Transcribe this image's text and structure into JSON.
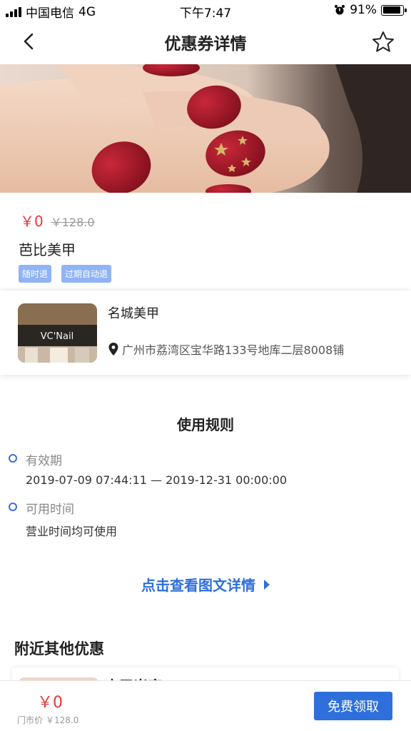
{
  "status_bar": {
    "carrier": "中国电信",
    "network": "4G",
    "time": "下午7:47",
    "battery": "91%"
  },
  "nav": {
    "title": "优惠券详情",
    "back_icon": "chevron-left-icon",
    "favorite_icon": "star-outline-icon"
  },
  "product": {
    "price": "￥0",
    "original_price": "￥128.0",
    "name": "芭比美甲",
    "tags": [
      "随时退",
      "过期自动退"
    ]
  },
  "store": {
    "name": "名城美甲",
    "address": "广州市荔湾区宝华路133号地库二层8008铺",
    "sign_text": "VC'Nail"
  },
  "rules": {
    "title": "使用规则",
    "items": [
      {
        "label": "有效期",
        "value": "2019-07-09 07:44:11 — 2019-12-31 00:00:00"
      },
      {
        "label": "可用时间",
        "value": "营业时间均可使用"
      }
    ]
  },
  "detail_link": "点击查看图文详情",
  "nearby": {
    "title": "附近其他优惠",
    "first_item_name": "本甲米库"
  },
  "bottom": {
    "price": "￥0",
    "market_label": "门市价",
    "market_price": "￥128.0",
    "button": "免费领取"
  },
  "colors": {
    "accent_blue": "#2e6fdb",
    "price_red": "#e53935",
    "tag_blue": "#8fb3f5"
  }
}
